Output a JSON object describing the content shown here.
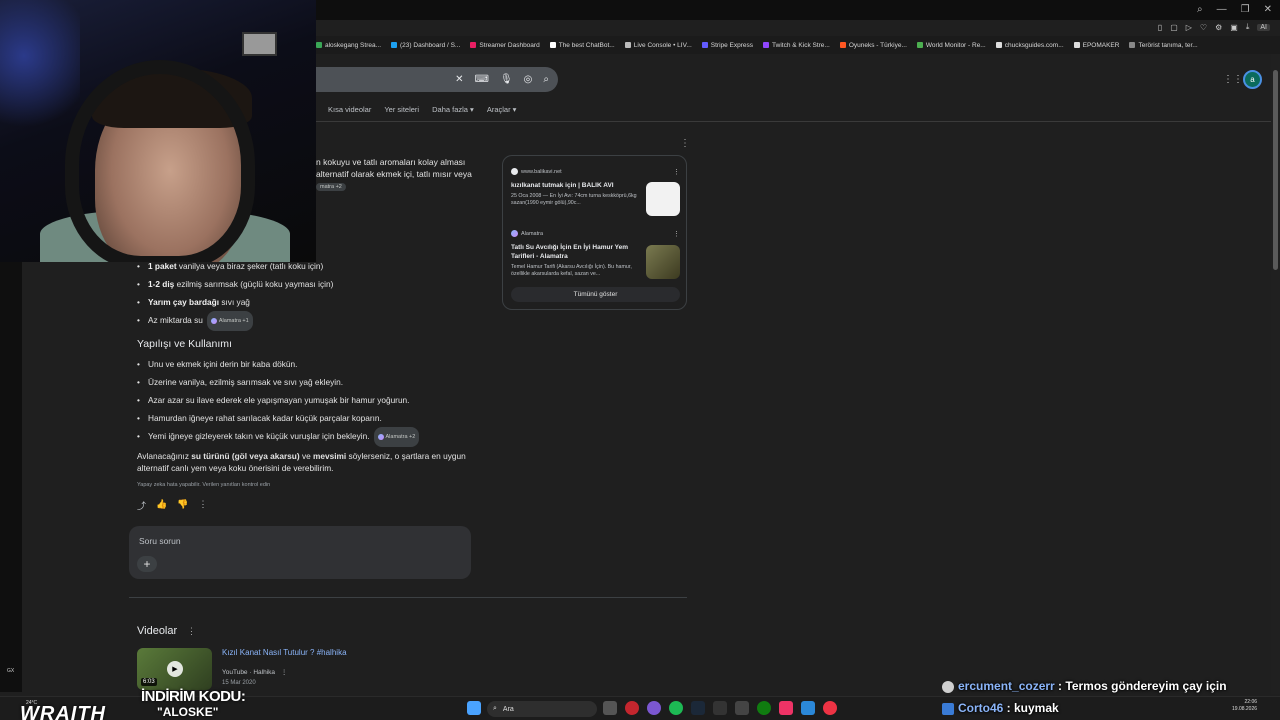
{
  "bookmarks": [
    {
      "label": "aloskegang Strea...",
      "color": "#3aa757"
    },
    {
      "label": "(23) Dashboard / S...",
      "color": "#1da1f2"
    },
    {
      "label": "Streamer Dashboard",
      "color": "#e91e63"
    },
    {
      "label": "The best ChatBot...",
      "color": "#ffffff"
    },
    {
      "label": "Live Console • LIV...",
      "color": "#bbbbbb"
    },
    {
      "label": "Stripe Express",
      "color": "#635bff"
    },
    {
      "label": "Twitch & Kick Stre...",
      "color": "#9146ff"
    },
    {
      "label": "Oyuneks - Türkiye...",
      "color": "#ff5722"
    },
    {
      "label": "World Monitor - Re...",
      "color": "#4caf50"
    },
    {
      "label": "chucksguides.com...",
      "color": "#dddddd"
    },
    {
      "label": "EPOMAKER",
      "color": "#dddddd"
    },
    {
      "label": "Terörist tanıma, ter...",
      "color": "#888888"
    }
  ],
  "extensions": {
    "ai_label": "AI"
  },
  "tabs": [
    "Kısa videolar",
    "Yer siteleri",
    "Daha fazla ▾",
    "Araçlar ▾"
  ],
  "avatar_letter": "a",
  "fragments": {
    "line1": "n kokuyu ve tatlı aromaları kolay alması",
    "line2": "alternatif olarak ekmek içi, tatlı mısır veya",
    "line3_chip": "matra +2"
  },
  "ingredients": [
    {
      "bold": "1 paket",
      "rest": " vanilya veya biraz şeker (tatlı koku için)",
      "chip": ""
    },
    {
      "bold": "1-2 diş",
      "rest": " ezilmiş sarımsak (güçlü koku yayması için)",
      "chip": ""
    },
    {
      "bold": "Yarım çay bardağı",
      "rest": " sıvı yağ",
      "chip": ""
    },
    {
      "bold": "",
      "rest": "Az miktarda su",
      "chip": "Alamatra +1"
    }
  ],
  "section_title": "Yapılışı ve Kullanımı",
  "steps": [
    {
      "text": "Unu ve ekmek içini derin bir kaba dökün.",
      "chip": ""
    },
    {
      "text": "Üzerine vanilya, ezilmiş sarımsak ve sıvı yağ ekleyin.",
      "chip": ""
    },
    {
      "text": "Azar azar su ilave ederek ele yapışmayan yumuşak bir hamur yoğurun.",
      "chip": ""
    },
    {
      "text": "Hamurdan iğneye rahat sarılacak kadar küçük parçalar koparın.",
      "chip": ""
    },
    {
      "text": "Yemi iğneye gizleyerek takın ve küçük vuruşlar için bekleyin.",
      "chip": "Alamatra +2"
    }
  ],
  "paragraph": {
    "a": "Avlanacağınız ",
    "b": "su türünü (göl veya akarsu)",
    "c": " ve ",
    "d": "mevsimi",
    "e": " söylerseniz, o şartlara en uygun alternatif canlı yem veya koku önerisini de verebilirim."
  },
  "disclaimer": "Yapay zeka hata yapabilir. Verilen yanıtları kontrol edin",
  "ask_placeholder": "Soru sorun",
  "sources": [
    {
      "site": "www.balikavi.net",
      "title": "kızılkanat tutmak için | BALIK AVI",
      "snippet": "25 Oca 2008 — En İyi Avı: 74cm turna keskköprü,6kg sazan(1990 eymir gölü),90c..."
    },
    {
      "site": "Alamatra",
      "title": "Tatlı Su Avcılığı İçin En İyi Hamur Yem Tarifleri - Alamatra",
      "snippet": "Temel Hamur Tarifi (Akarsu Avcılığı İçin). Bu hamur, özellikle akarsularda kefal, sazan ve..."
    }
  ],
  "show_all": "Tümünü göster",
  "videos": {
    "title": "Videolar",
    "item": {
      "title": "Kızıl Kanat Nasıl Tutulur ? #halhika",
      "source": "YouTube · Halhika",
      "date": "15 Mar 2020",
      "duration": "6:03"
    }
  },
  "taskbar": {
    "search": "Ara",
    "time": "22:06",
    "date": "19.08.2026"
  },
  "overlay": {
    "promo_line1": "İNDİRİM KODU:",
    "promo_line2": "\"ALOSKE\"",
    "brand": "WRAITH",
    "temp": "24°C",
    "gx": "GX"
  },
  "chat": [
    {
      "user": "ercument_cozerr",
      "message": " : Termos göndereyim çay için"
    },
    {
      "user": "Corto46",
      "message": " : kuymak"
    }
  ]
}
